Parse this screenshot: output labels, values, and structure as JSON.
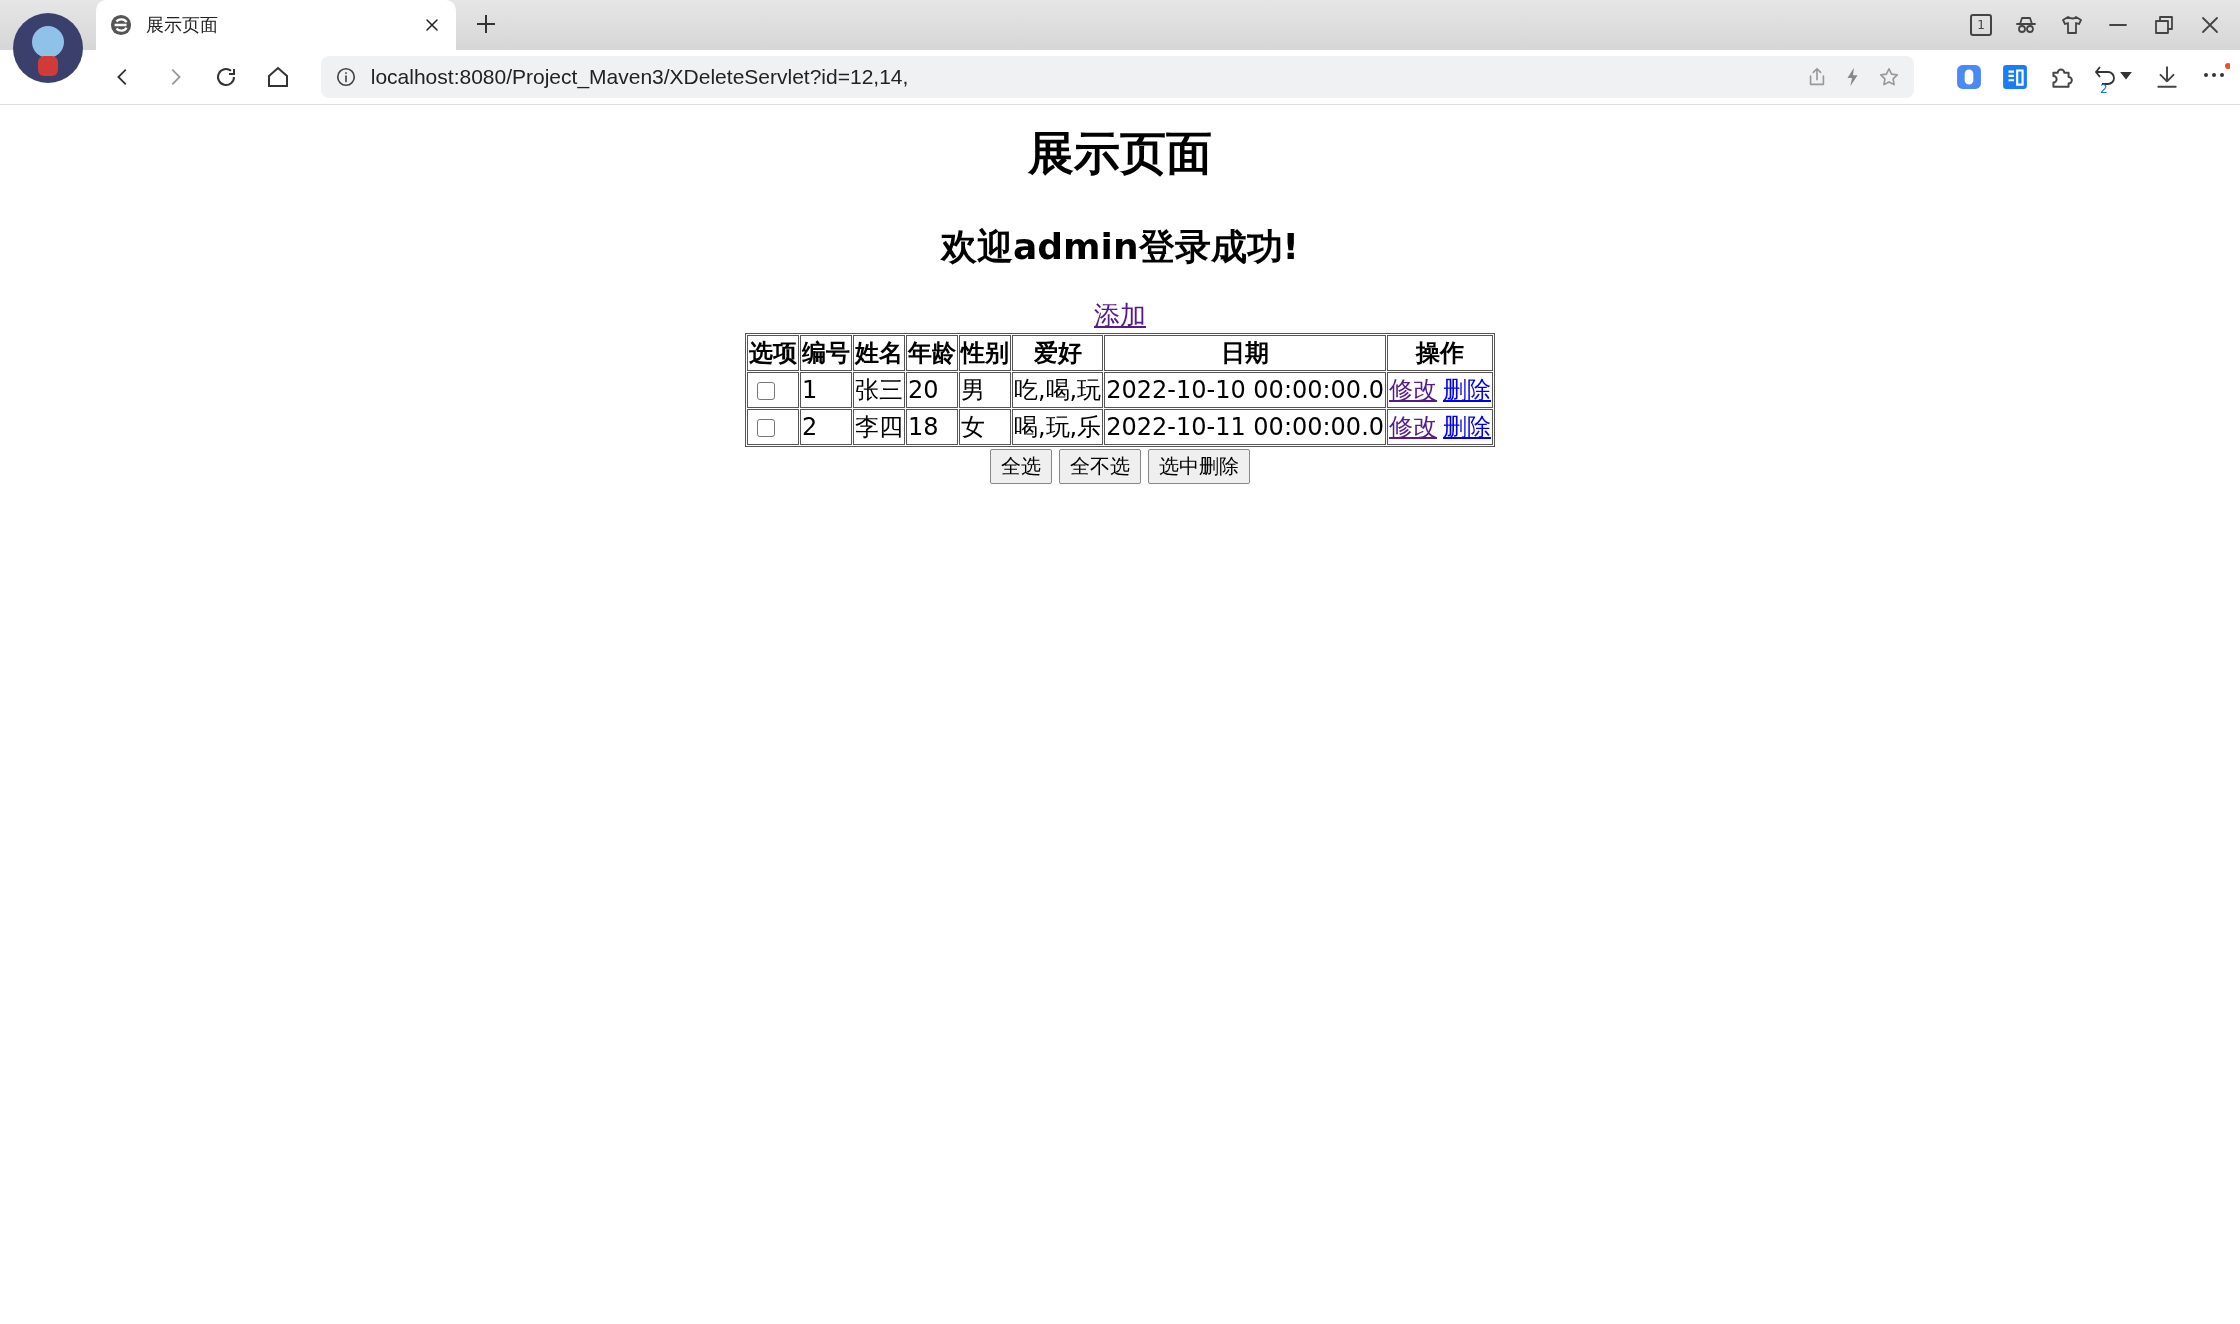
{
  "browser": {
    "tab": {
      "title": "展示页面",
      "selected": true
    },
    "address": "localhost:8080/Project_Maven3/XDeleteServlet?id=12,14,",
    "tab_count": "1",
    "undo_badge": "2"
  },
  "page": {
    "title": "展示页面",
    "welcome": "欢迎admin登录成功!",
    "add_link": {
      "label": "添加",
      "visited": true
    },
    "table": {
      "columns": [
        "选项",
        "编号",
        "姓名",
        "年龄",
        "性别",
        "爱好",
        "日期",
        "操作"
      ],
      "rows": [
        {
          "checked": false,
          "id": "1",
          "name": "张三",
          "age": "20",
          "gender": "男",
          "hobby": "吃,喝,玩",
          "date": "2022-10-10 00:00:00.0",
          "actions": [
            {
              "label": "修改",
              "visited": true
            },
            {
              "label": "删除",
              "visited": false
            }
          ]
        },
        {
          "checked": false,
          "id": "2",
          "name": "李四",
          "age": "18",
          "gender": "女",
          "hobby": "喝,玩,乐",
          "date": "2022-10-11 00:00:00.0",
          "actions": [
            {
              "label": "修改",
              "visited": true
            },
            {
              "label": "删除",
              "visited": false
            }
          ]
        }
      ]
    },
    "buttons": [
      "全选",
      "全不选",
      "选中删除"
    ]
  }
}
